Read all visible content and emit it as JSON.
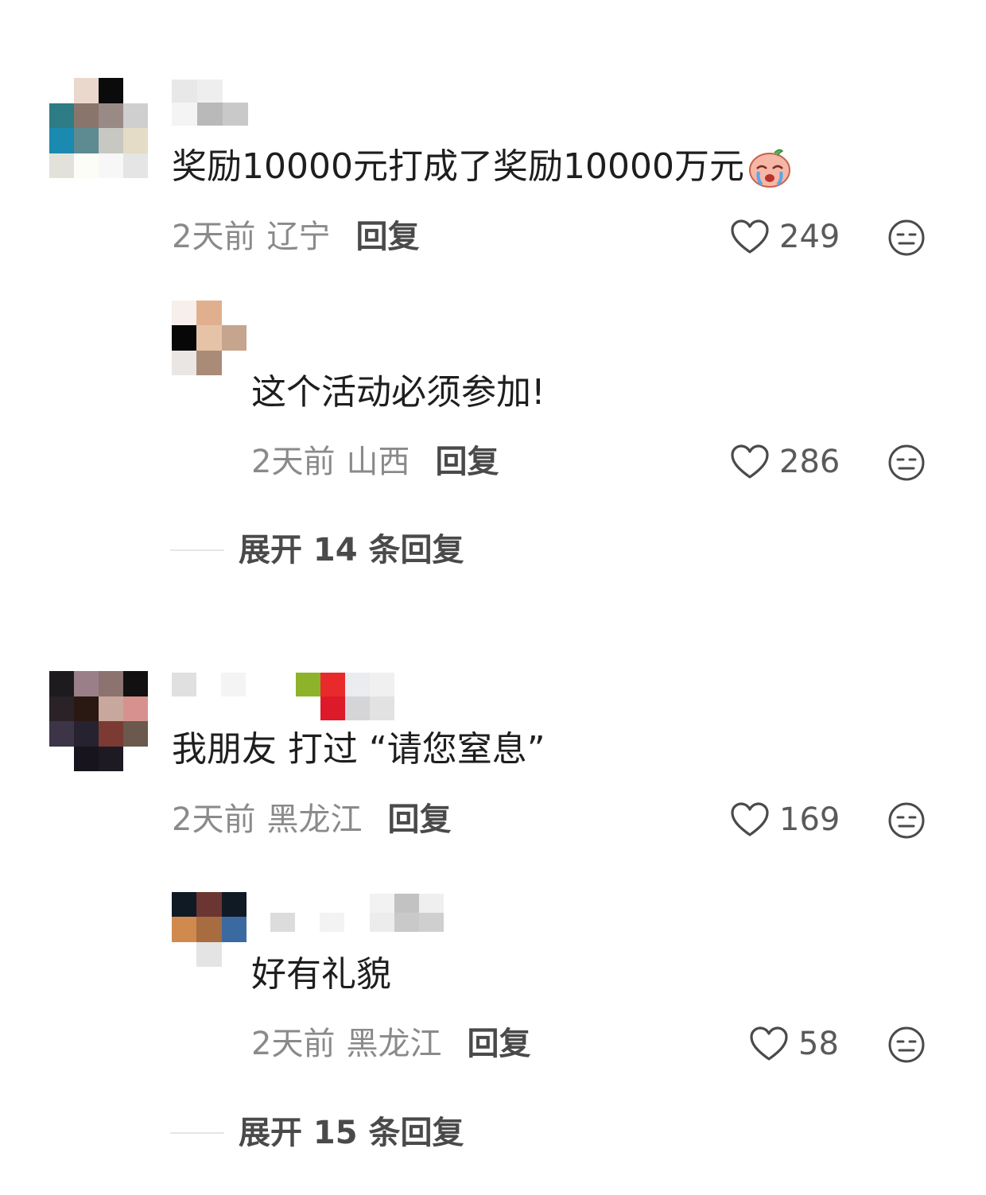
{
  "comments": [
    {
      "text": "奖励10000元打成了奖励10000万元",
      "emoji": "crying-face-emoji",
      "time": "2天前",
      "location": "辽宁",
      "reply_label": "回复",
      "likes": "249",
      "replies": [
        {
          "text": "这个活动必须参加!",
          "time": "2天前",
          "location": "山西",
          "reply_label": "回复",
          "likes": "286"
        }
      ],
      "expand_label": "展开 14 条回复"
    },
    {
      "text": "我朋友 打过 “请您窒息”",
      "time": "2天前",
      "location": "黑龙江",
      "reply_label": "回复",
      "likes": "169",
      "replies": [
        {
          "text": "好有礼貌",
          "time": "2天前",
          "location": "黑龙江",
          "reply_label": "回复",
          "likes": "58"
        }
      ],
      "expand_label": "展开 15 条回复"
    }
  ],
  "icons": {
    "like": "heart-outline-icon",
    "dislike": "meh-face-icon"
  },
  "colors": {
    "text": "#1e1e1e",
    "meta": "#8a8a8a",
    "icon": "#4a4a4a"
  }
}
